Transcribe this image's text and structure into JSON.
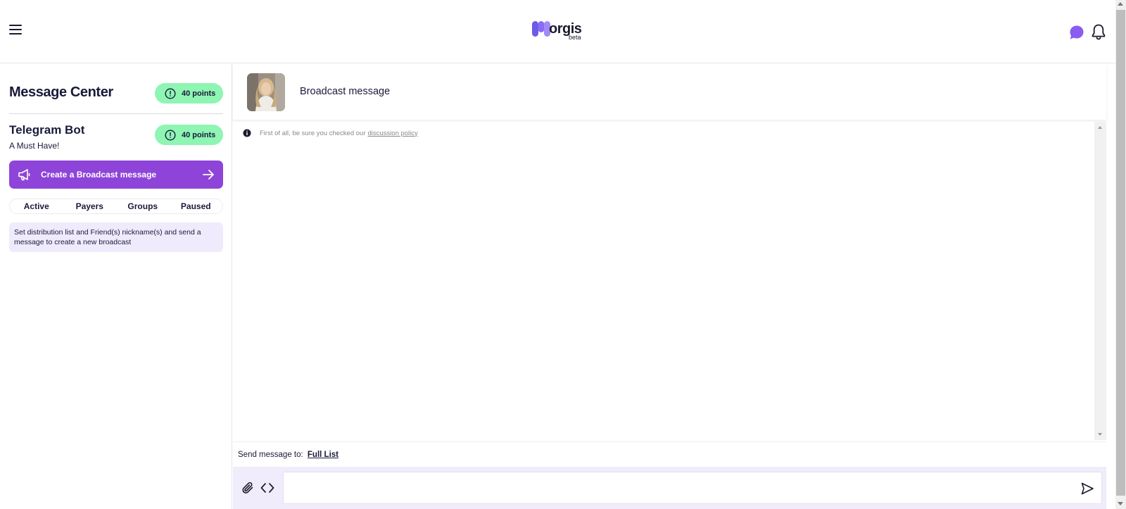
{
  "header": {
    "logo_text": "orgis",
    "logo_beta": "beta",
    "colors": {
      "logo_purple": "#7b5ce8",
      "chat_icon": "#8a5cf0"
    }
  },
  "sidebar": {
    "title": "Message Center",
    "points_label": "40 points",
    "bot": {
      "title": "Telegram Bot",
      "subtitle": "A Must Have!",
      "points_label": "40 points"
    },
    "create_button_label": "Create a Broadcast message",
    "tabs": [
      "Active",
      "Payers",
      "Groups",
      "Paused"
    ],
    "hint": "Set distribution list and Friend(s) nickname(s) and send a message to create a new broadcast",
    "colors": {
      "points_badge": "#8ef5b3",
      "create_button": "#8e44d8",
      "hint_bg": "#efebfc"
    }
  },
  "chat": {
    "title": "Broadcast message",
    "policy_text": "First of all, be sure you checked our",
    "policy_link": "discussion policy",
    "send_to_label": "Send message to:",
    "send_to_value": "Full List",
    "input_placeholder": "",
    "input_value": ""
  }
}
